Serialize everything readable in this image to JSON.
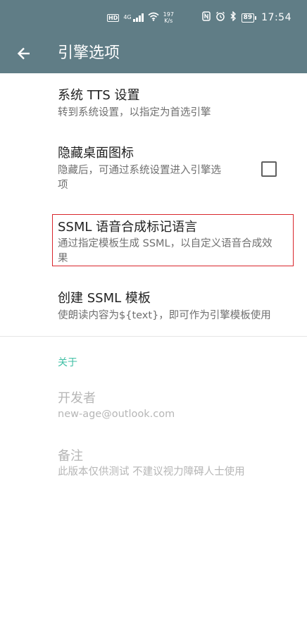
{
  "status_bar": {
    "network_badge": "HD",
    "network_type": "4G",
    "speed_value": "197",
    "speed_unit": "K/s",
    "battery": "89",
    "time": "17:54"
  },
  "toolbar": {
    "title": "引擎选项"
  },
  "preferences": {
    "system_tts": {
      "title": "系统 TTS 设置",
      "summary": "转到系统设置，以指定为首选引擎"
    },
    "hide_icon": {
      "title": "隐藏桌面图标",
      "summary_line1": "隐藏后，可通过系统设置进入引擎选",
      "summary_line2": "项"
    },
    "ssml": {
      "title": "SSML 语音合成标记语言",
      "summary_line1": "通过指定模板生成 SSML，以自定义语音合成效",
      "summary_line2": "果"
    },
    "create_template": {
      "title": "创建 SSML 模板",
      "summary": "使朗读内容为${text}，即可作为引擎模板使用"
    }
  },
  "about": {
    "category": "关于",
    "developer": {
      "title": "开发者",
      "summary": "new-age@outlook.com"
    },
    "notes": {
      "title": "备注",
      "summary": "此版本仅供测试 不建议视力障碍人士使用"
    }
  },
  "colors": {
    "toolbar_bg": "#607d86",
    "accent": "#3fbfa4",
    "highlight": "#d9262c"
  }
}
